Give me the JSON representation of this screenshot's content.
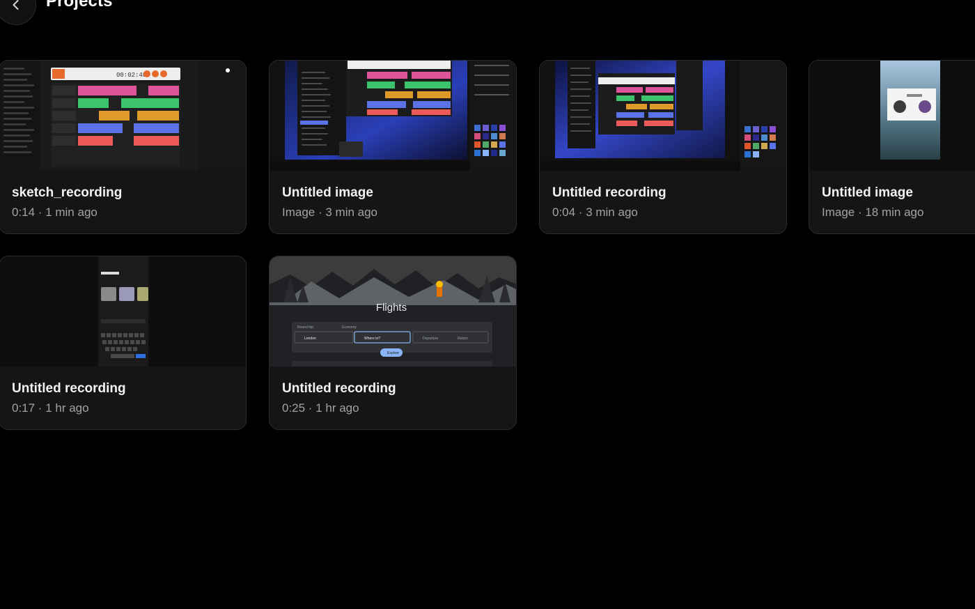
{
  "header": {
    "title": "Projects",
    "back_icon": "chevron-left-icon"
  },
  "projects": [
    {
      "title": "sketch_recording",
      "meta": "0:14 · 1 min ago",
      "kind": "recording"
    },
    {
      "title": "Untitled image",
      "meta": "Image · 3 min ago",
      "kind": "image"
    },
    {
      "title": "Untitled recording",
      "meta": "0:04 · 3 min ago",
      "kind": "recording"
    },
    {
      "title": "Untitled image",
      "meta": "Image · 18 min ago",
      "kind": "image"
    },
    {
      "title": "Untitled recording",
      "meta": "0:17 · 1 hr ago",
      "kind": "recording"
    },
    {
      "title": "Untitled recording",
      "meta": "0:25 · 1 hr ago",
      "kind": "recording"
    }
  ],
  "thumbnails": {
    "timer": "00:02:48",
    "flights_title": "Flights",
    "flights_from": "London",
    "flights_to": "Where to?",
    "flights_departure": "Departure",
    "flights_return": "Return",
    "flights_explore": "Explore",
    "flights_trip": "Round trip",
    "flights_class": "Economy"
  },
  "colors": {
    "background": "#000000",
    "card": "#151515",
    "card_border": "#2c2c2c",
    "meta_text": "#a3a3a3",
    "track_pink": "#e0559a",
    "track_green": "#3cc46b",
    "track_orange": "#e09a2c",
    "track_blue": "#5a73e8",
    "track_red": "#ec5a5a",
    "accent_blue": "#8ab4f8"
  }
}
